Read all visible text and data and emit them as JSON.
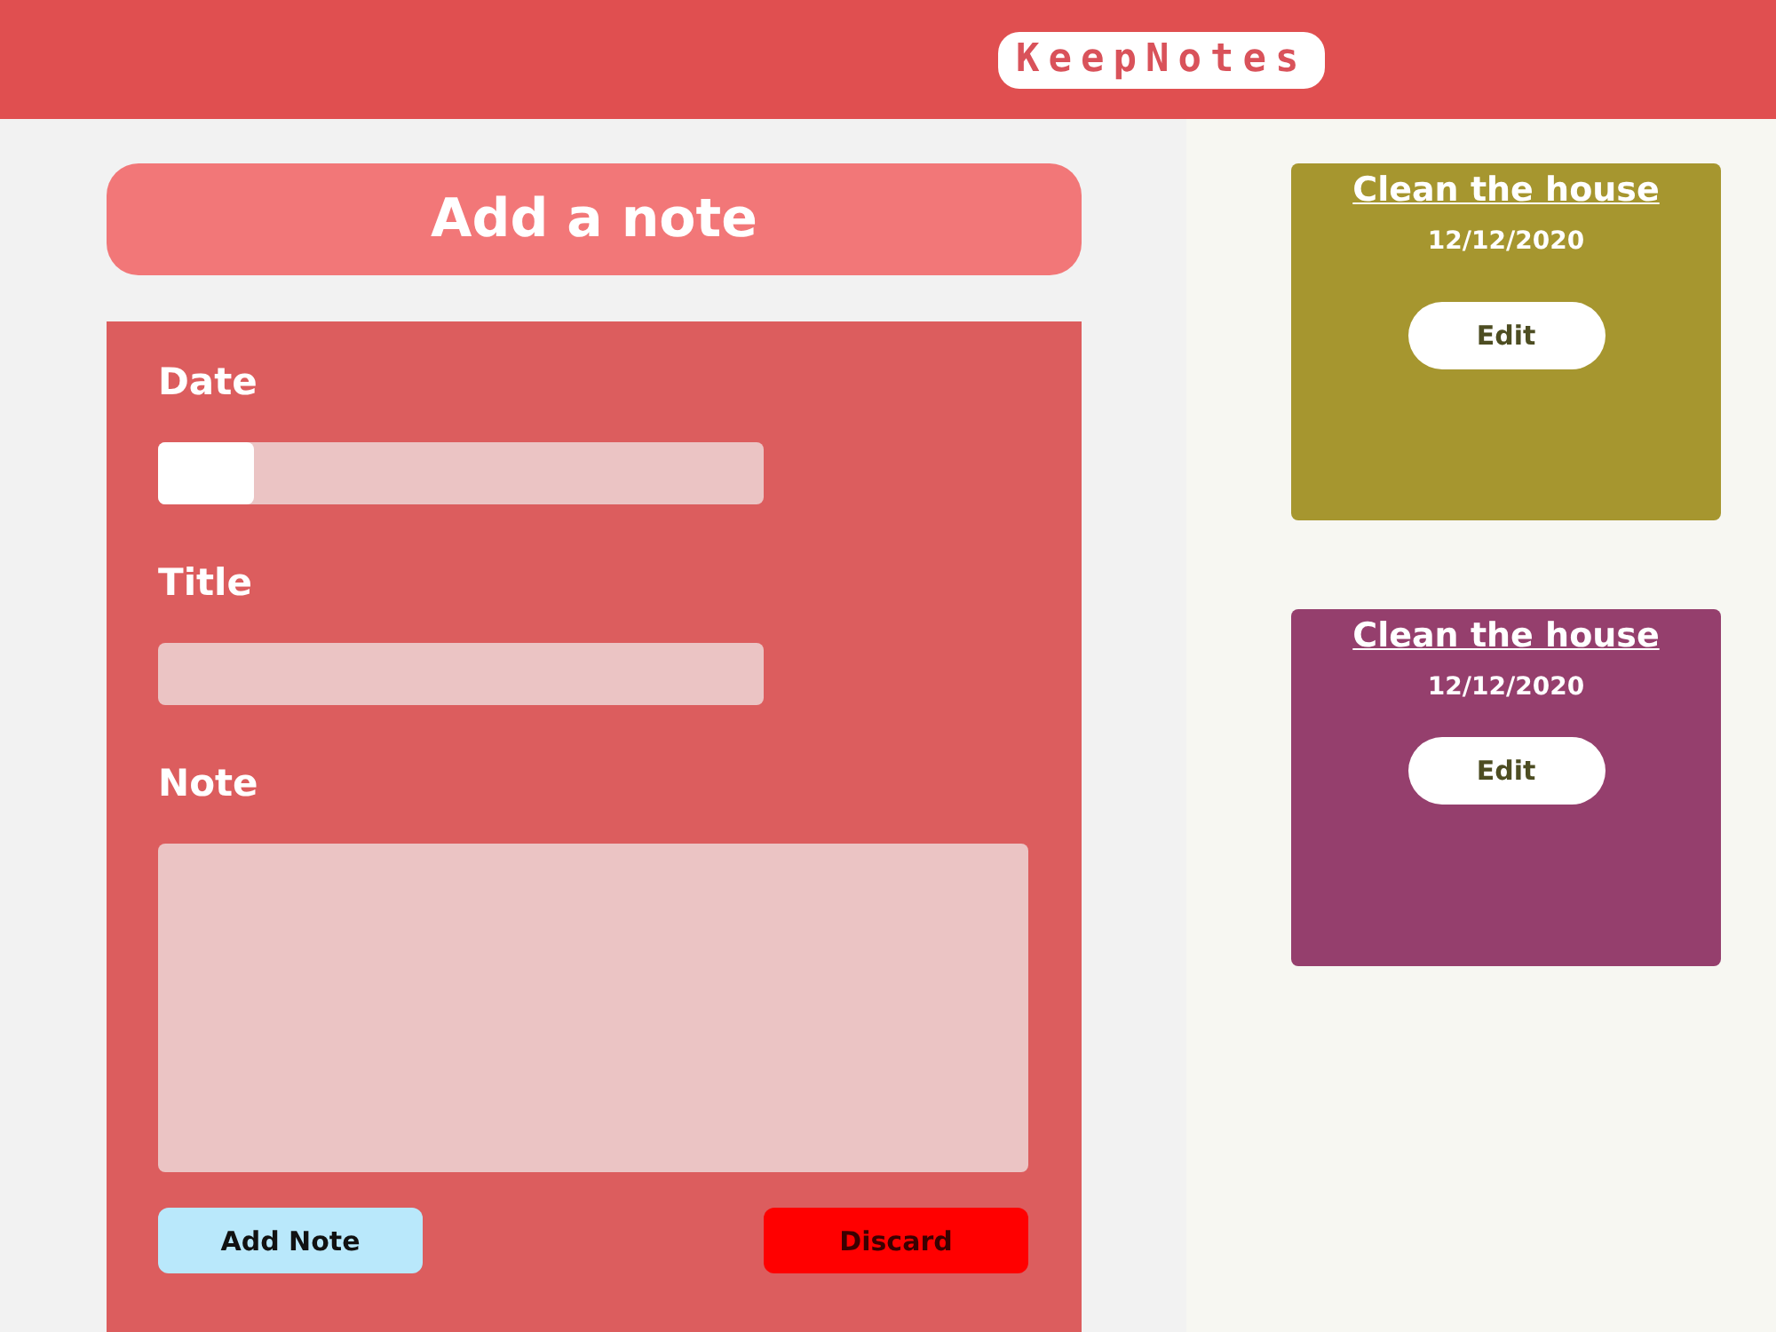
{
  "header": {
    "logo": "KeepNotes"
  },
  "form": {
    "heading": "Add a note",
    "fields": [
      {
        "label": "Date",
        "kind": "date"
      },
      {
        "label": "Title",
        "kind": "text"
      },
      {
        "label": "Note",
        "kind": "textarea"
      }
    ],
    "buttons": [
      {
        "label": "Add Note",
        "kind": "primary"
      },
      {
        "label": "Discard",
        "kind": "danger"
      }
    ]
  },
  "notes": [
    {
      "title": "Clean the house",
      "date": "12/12/2020",
      "button": "Edit",
      "color": "#a6962f"
    },
    {
      "title": "Clean the house",
      "date": "12/12/2020",
      "button": "Edit",
      "color": "#953f6d"
    }
  ]
}
